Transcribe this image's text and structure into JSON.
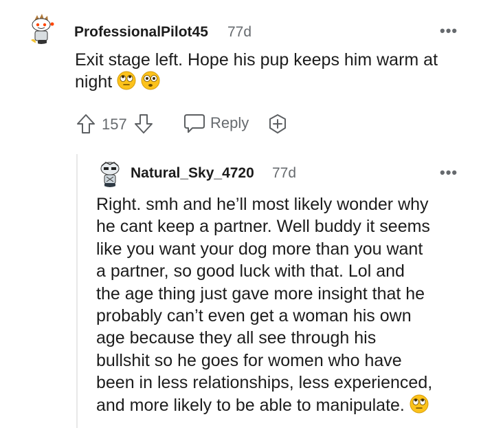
{
  "comment1": {
    "username": "ProfessionalPilot45",
    "time": "77d",
    "more": "•••",
    "text": "Exit stage left. Hope his pup keeps him warm at night",
    "emojis": [
      "face-with-rolling-eyes",
      "flushed-face"
    ],
    "upvotes": "157",
    "reply_label": "Reply"
  },
  "comment2": {
    "username": "Natural_Sky_4720",
    "time": "77d",
    "more": "•••",
    "lines": [
      "Right. smh and he’ll most likely wonder why",
      "he cant keep a partner. Well buddy it seems",
      "like you want your dog more than you want",
      "a partner, so good luck with that. Lol and",
      "the age thing just gave more insight that he",
      "probably can’t even get a woman his own",
      "age because they all see through his",
      "bullshit so he goes for women who have",
      "been in less relationships, less experienced,",
      "and more likely to be able to manipulate."
    ],
    "emojis": [
      "face-with-rolling-eyes"
    ]
  }
}
